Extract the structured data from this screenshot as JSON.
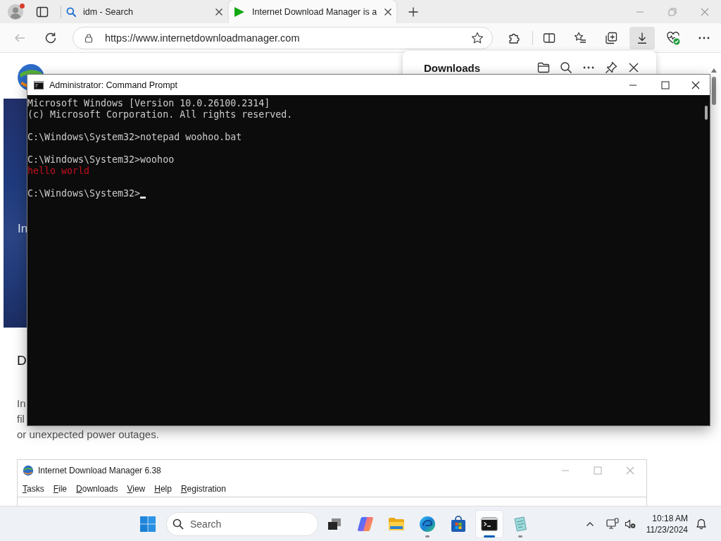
{
  "browser": {
    "tabs": [
      {
        "kind": "search",
        "title": "idm - Search",
        "selected": false
      },
      {
        "kind": "site",
        "title": "Internet Download Manager is a",
        "selected": true
      }
    ],
    "address_bar": {
      "url": "https://www.internetdownloadmanager.com"
    },
    "downloads_panel": {
      "open": true,
      "title": "Downloads"
    }
  },
  "website": {
    "banner_text": "In",
    "heading": "D",
    "paragraph_lines": [
      "In",
      "fil",
      "or unexpected power outages."
    ],
    "app_screenshot": {
      "title": "Internet Download Manager 6.38",
      "menu": [
        "Tasks",
        "File",
        "Downloads",
        "View",
        "Help",
        "Registration"
      ]
    }
  },
  "command_prompt": {
    "title": "Administrator: Command Prompt",
    "lines": [
      {
        "kind": "text",
        "text": "Microsoft Windows [Version 10.0.26100.2314]",
        "color": "#cccccc",
        "cursor": false
      },
      {
        "kind": "text",
        "text": "(c) Microsoft Corporation. All rights reserved.",
        "color": "#cccccc",
        "cursor": false
      },
      {
        "kind": "blank",
        "cursor": false
      },
      {
        "kind": "text",
        "text": "C:\\Windows\\System32>notepad woohoo.bat",
        "color": "#cccccc",
        "cursor": false
      },
      {
        "kind": "blank",
        "cursor": false
      },
      {
        "kind": "text",
        "text": "C:\\Windows\\System32>woohoo",
        "color": "#cccccc",
        "cursor": false
      },
      {
        "kind": "text",
        "text": "hello world",
        "color": "#c50f1f",
        "cursor": false
      },
      {
        "kind": "blank",
        "cursor": false
      },
      {
        "kind": "text",
        "text": "C:\\Windows\\System32>",
        "color": "#cccccc",
        "cursor": true
      }
    ]
  },
  "taskbar": {
    "search": {
      "placeholder": "Search"
    },
    "apps": [
      {
        "kind": "taskview",
        "running": false,
        "selected": false
      },
      {
        "kind": "assistant",
        "running": false,
        "selected": false
      },
      {
        "kind": "files",
        "running": false,
        "selected": false
      },
      {
        "kind": "browser",
        "running": true,
        "selected": false
      },
      {
        "kind": "store",
        "running": false,
        "selected": false
      },
      {
        "kind": "terminal",
        "running": true,
        "selected": true
      },
      {
        "kind": "notepad",
        "running": true,
        "selected": false
      }
    ],
    "clock": {
      "time": "10:18 AM",
      "date": "11/23/2024"
    }
  }
}
